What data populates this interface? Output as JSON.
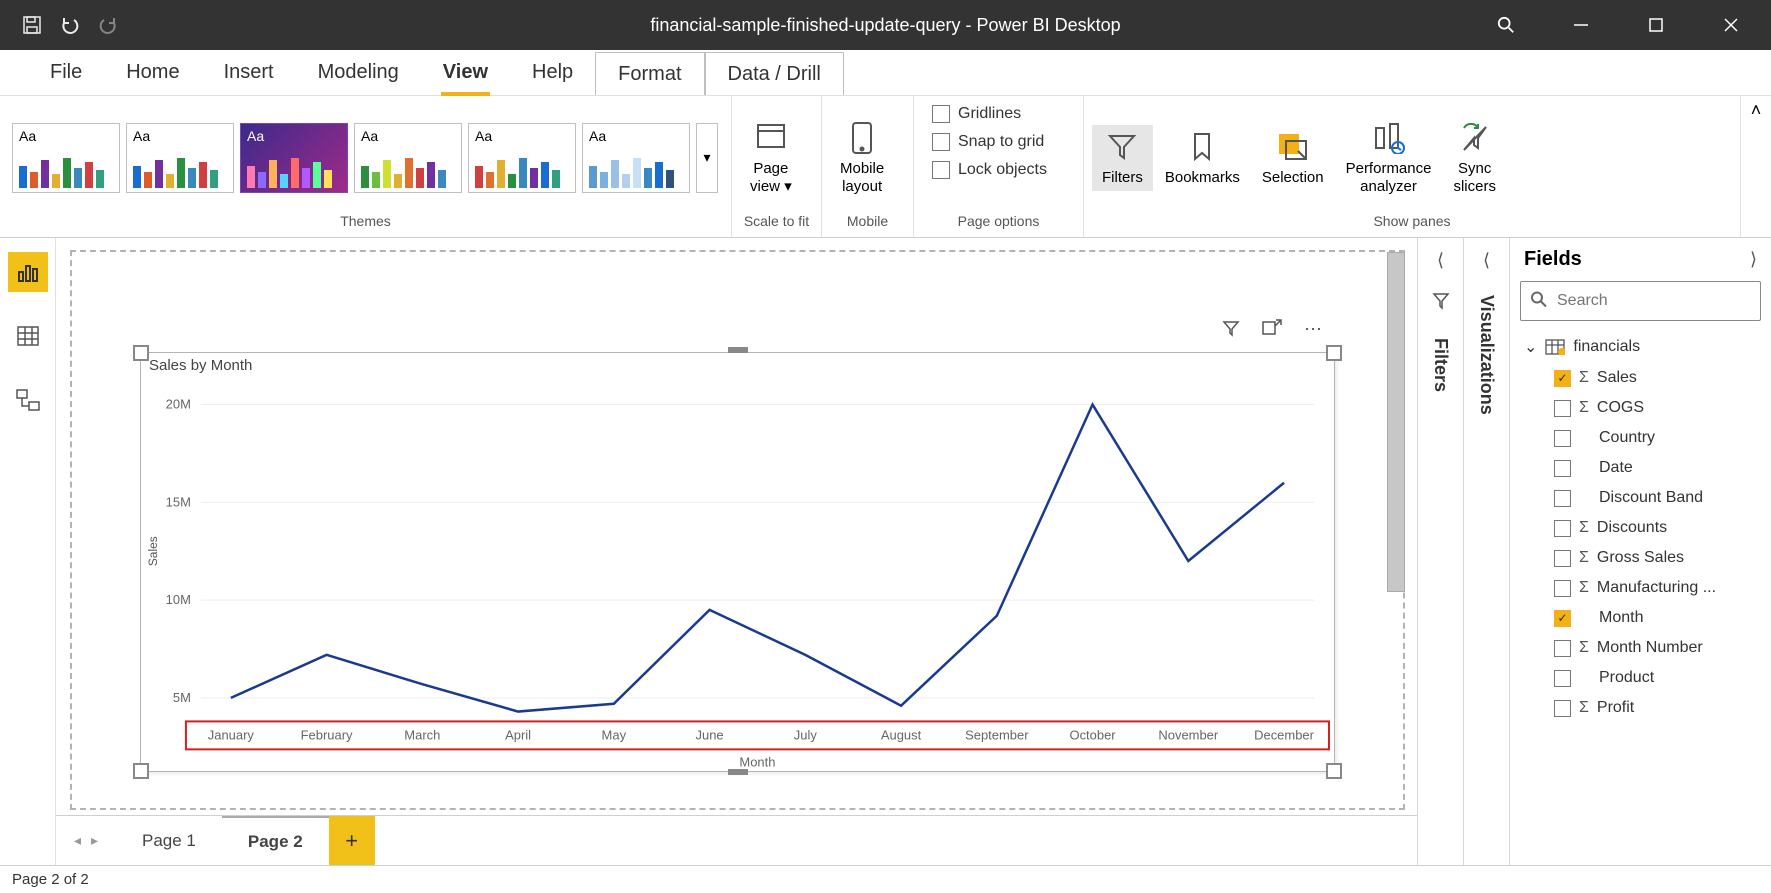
{
  "title": "financial-sample-finished-update-query - Power BI Desktop",
  "tabs": [
    "File",
    "Home",
    "Insert",
    "Modeling",
    "View",
    "Help",
    "Format",
    "Data / Drill"
  ],
  "active_tab": "View",
  "highlight_tabs": [
    "Format",
    "Data / Drill"
  ],
  "ribbon": {
    "themes_label": "Themes",
    "scale_label": "Scale to fit",
    "mobile_label": "Mobile",
    "pageopts_label": "Page options",
    "showpanes_label": "Show panes",
    "page_view": "Page\nview",
    "mobile_layout": "Mobile\nlayout",
    "chk_gridlines": "Gridlines",
    "chk_snap": "Snap to grid",
    "chk_lock": "Lock objects",
    "filters": "Filters",
    "bookmarks": "Bookmarks",
    "selection": "Selection",
    "performance": "Performance\nanalyzer",
    "sync": "Sync\nslicers"
  },
  "panes": {
    "filters": "Filters",
    "visualizations": "Visualizations",
    "fields": "Fields"
  },
  "search_placeholder": "Search",
  "fields_tree": {
    "table": "financials",
    "items": [
      {
        "label": "Sales",
        "checked": true,
        "sigma": true
      },
      {
        "label": "COGS",
        "checked": false,
        "sigma": true
      },
      {
        "label": "Country",
        "checked": false,
        "sigma": false
      },
      {
        "label": "Date",
        "checked": false,
        "sigma": false
      },
      {
        "label": "Discount Band",
        "checked": false,
        "sigma": false
      },
      {
        "label": "Discounts",
        "checked": false,
        "sigma": true
      },
      {
        "label": "Gross Sales",
        "checked": false,
        "sigma": true
      },
      {
        "label": "Manufacturing ...",
        "checked": false,
        "sigma": true
      },
      {
        "label": "Month",
        "checked": true,
        "sigma": false
      },
      {
        "label": "Month Number",
        "checked": false,
        "sigma": true
      },
      {
        "label": "Product",
        "checked": false,
        "sigma": false
      },
      {
        "label": "Profit",
        "checked": false,
        "sigma": true
      }
    ]
  },
  "pages": {
    "tabs": [
      "Page 1",
      "Page 2"
    ],
    "active": "Page 2"
  },
  "status": "Page 2 of 2",
  "chart_data": {
    "type": "line",
    "title": "Sales by Month",
    "xlabel": "Month",
    "ylabel": "Sales",
    "categories": [
      "January",
      "February",
      "March",
      "April",
      "May",
      "June",
      "July",
      "August",
      "September",
      "October",
      "November",
      "December"
    ],
    "values": [
      5.0,
      7.2,
      5.7,
      4.3,
      4.7,
      9.5,
      7.2,
      4.6,
      9.2,
      20.0,
      12.0,
      16.0
    ],
    "y_ticks": [
      5,
      10,
      15,
      20
    ],
    "y_tick_labels": [
      "5M",
      "10M",
      "15M",
      "20M"
    ],
    "ylim": [
      4,
      20
    ]
  }
}
